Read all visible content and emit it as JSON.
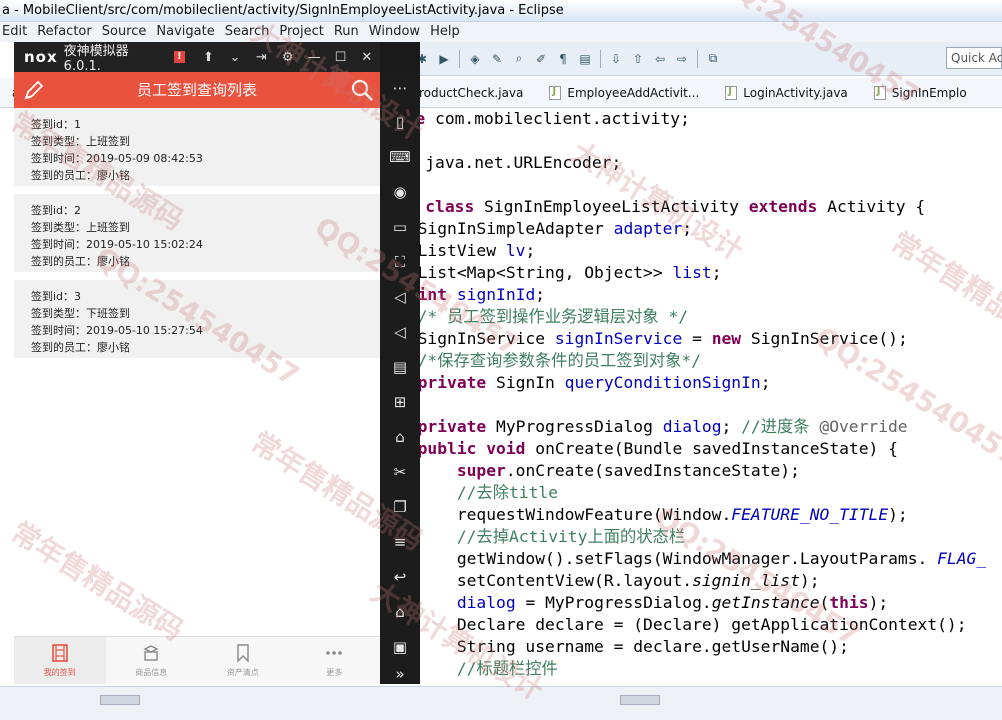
{
  "window": {
    "title": "a - MobileClient/src/com/mobileclient/activity/SignInEmployeeListActivity.java - Eclipse"
  },
  "menu": [
    "Edit",
    "Refactor",
    "Source",
    "Navigate",
    "Search",
    "Project",
    "Run",
    "Window",
    "Help"
  ],
  "toolbar": {
    "quick_access_placeholder": "Quick Acc"
  },
  "editor_tabs": [
    {
      "label": "ac"
    },
    {
      "label": "ProductCheck.java"
    },
    {
      "label": "EmployeeAddActivit..."
    },
    {
      "label": "LoginActivity.java"
    },
    {
      "label": "SignInEmplo"
    }
  ],
  "code_lines": [
    "kage com.mobileclient.activity;",
    "",
    "ort java.net.URLEncoder;",
    "",
    "lic class SignInEmployeeListActivity extends Activity {",
    "  SignInSimpleAdapter adapter;",
    "  ListView lv;",
    "  List<Map<String, Object>> list;",
    "  int signInId;",
    "  /* 员工签到操作业务逻辑层对象 */",
    "  SignInService signInService = new SignInService();",
    "  /*保存查询参数条件的员工签到对象*/",
    "  private SignIn queryConditionSignIn;",
    "",
    "  private MyProgressDialog dialog; //进度条 @Override",
    "  public void onCreate(Bundle savedInstanceState) {",
    "      super.onCreate(savedInstanceState);",
    "      //去除title",
    "      requestWindowFeature(Window.FEATURE_NO_TITLE);",
    "      //去掉Activity上面的状态栏",
    "      getWindow().setFlags(WindowManager.LayoutParams. FLAG_",
    "      setContentView(R.layout.signin_list);",
    "      dialog = MyProgressDialog.getInstance(this);",
    "      Declare declare = (Declare) getApplicationContext();",
    "      String username = declare.getUserName();",
    "      //标题栏控件"
  ],
  "emulator": {
    "logo": "nox",
    "name": "夜神模拟器 6.0.1.",
    "alert": "!"
  },
  "app": {
    "title": "员工签到查询列表",
    "records": [
      {
        "id": "签到id：1",
        "type": "签到类型：上班签到",
        "time": "签到时间：2019-05-09 08:42:53",
        "employee": "签到的员工：廖小铭"
      },
      {
        "id": "签到id：2",
        "type": "签到类型：上班签到",
        "time": "签到时间：2019-05-10 15:02:24",
        "employee": "签到的员工：廖小铭"
      },
      {
        "id": "签到id：3",
        "type": "签到类型：下班签到",
        "time": "签到时间：2019-05-10 15:27:54",
        "employee": "签到的员工：廖小铭"
      }
    ],
    "bottom_nav": [
      {
        "label": "我的签到",
        "active": true
      },
      {
        "label": "商品信息",
        "active": false
      },
      {
        "label": "资产清点",
        "active": false
      },
      {
        "label": "更多",
        "active": false
      }
    ]
  },
  "watermarks": [
    "常年售精品源码",
    "大神计算机设计",
    "QQ:254540457",
    "常年售精品源码",
    "QQ:254540457",
    "大神计算机设计",
    "QQ:254540457",
    "常年售精品源码",
    "QQ:254540457",
    "大神计算机设计",
    "常年售精品源码",
    "QQ:254540457"
  ],
  "colors": {
    "app_accent": "#e8523f",
    "keyword": "#7f0055",
    "field": "#0000c0",
    "comment": "#3f7f5f"
  }
}
